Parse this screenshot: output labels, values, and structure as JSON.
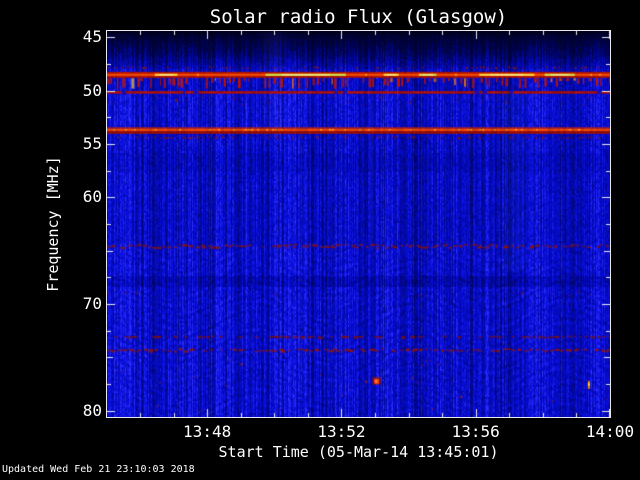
{
  "title": "Solar radio Flux (Glasgow)",
  "footer": {
    "updated_text": "Updated Wed Feb 21 23:10:03 2018"
  },
  "chart_data": {
    "type": "heatmap",
    "title": "Solar radio Flux (Glasgow)",
    "xlabel": "Start Time (05-Mar-14 13:45:01)",
    "ylabel": "Frequency [MHz]",
    "x_start_time": "13:45:01",
    "x_end_time": "14:00:00",
    "x_span_seconds": 899,
    "x_ticks": [
      {
        "label": "13:48",
        "frac": 0.1991
      },
      {
        "label": "13:52",
        "frac": 0.4661
      },
      {
        "label": "13:56",
        "frac": 0.733
      },
      {
        "label": "14:00",
        "frac": 1.0
      }
    ],
    "x_minor_tick_minutes": 1,
    "y_ticks": [
      {
        "label": "45",
        "freq": 45
      },
      {
        "label": "50",
        "freq": 50
      },
      {
        "label": "55",
        "freq": 55
      },
      {
        "label": "60",
        "freq": 60
      },
      {
        "label": "70",
        "freq": 70
      },
      {
        "label": "80",
        "freq": 80
      }
    ],
    "y_minor_tick_mhz": 2.5,
    "ylim": [
      44.42,
      80.58
    ],
    "background_color": "#000000",
    "text_color": "#ffffff",
    "axis_color": "#e9e9ef",
    "base_palette": [
      "#000010",
      "#000240",
      "#0208a8",
      "#0a10de",
      "#3030ff",
      "#5a5aff"
    ],
    "rfi_bands": [
      {
        "kind": "dotted-line",
        "f0": 47.72,
        "f1": 47.95,
        "color": "#96190a",
        "density": 0.5
      },
      {
        "kind": "strong-band",
        "f0": 48.2,
        "f1": 48.85,
        "edge": "#c01400",
        "core": "#f04800",
        "yellow": "#ffd83c",
        "yellow2": "#cce24a",
        "bright": "#fff0b0",
        "segments": [
          [
            0.095,
            0.045
          ],
          [
            0.315,
            0.16
          ],
          [
            0.55,
            0.03
          ],
          [
            0.62,
            0.035
          ],
          [
            0.74,
            0.11
          ],
          [
            0.87,
            0.06
          ]
        ]
      },
      {
        "kind": "spike-curtain",
        "f0": 48.85,
        "f1": 49.85,
        "color": "#c41400",
        "alt1": "#f07800",
        "alt2": "#ffd020"
      },
      {
        "kind": "line",
        "f0": 50.06,
        "f1": 50.28,
        "color": "#c81400",
        "gaps": 9
      },
      {
        "kind": "speckle",
        "f0": 50.4,
        "f1": 51.3,
        "color": "#a01200",
        "count": 26
      },
      {
        "kind": "strong-line",
        "f0": 53.45,
        "f1": 54.05,
        "edge": "#d82400",
        "core": "#ff4a00",
        "low": "#a81000",
        "fleck": "#ffb428"
      },
      {
        "kind": "dotted-line",
        "f0": 54.28,
        "f1": 54.48,
        "color": "#8c1200",
        "density": 0.45
      },
      {
        "kind": "dash-band",
        "f0": 64.35,
        "f1": 64.8,
        "color": "#8c1400",
        "density": 0.7
      },
      {
        "kind": "speckle",
        "f0": 68.8,
        "f1": 69.3,
        "color": "#8c1400",
        "count": 16
      },
      {
        "kind": "dash-band",
        "f0": 72.95,
        "f1": 73.2,
        "color": "#821000",
        "density": 0.45
      },
      {
        "kind": "dash-band",
        "f0": 74.15,
        "f1": 74.5,
        "color": "#961400",
        "density": 0.65
      },
      {
        "kind": "speckle",
        "f0": 75.0,
        "f1": 80.3,
        "color": "#b42000",
        "count": 30
      }
    ],
    "events": [
      {
        "kind": "burst-blob",
        "time_frac": 0.533,
        "freq": 77.0,
        "color": "#ff3c00"
      },
      {
        "kind": "spike",
        "time_frac": 0.956,
        "freq": 77.2,
        "color": "#e88800",
        "tip": "#ffd040"
      }
    ],
    "haze_columns": [
      {
        "x0_frac": 0.3,
        "x1_frac": 0.36,
        "f0": 44.5,
        "f1": 54.5,
        "alpha": 0.1
      },
      {
        "x0_frac": 0.78,
        "x1_frac": 0.84,
        "f0": 50.0,
        "f1": 67.0,
        "alpha": 0.07
      },
      {
        "x0_frac": 0.522,
        "x1_frac": 0.53,
        "f0": 50.0,
        "f1": 65.0,
        "alpha": 0.12
      }
    ]
  }
}
